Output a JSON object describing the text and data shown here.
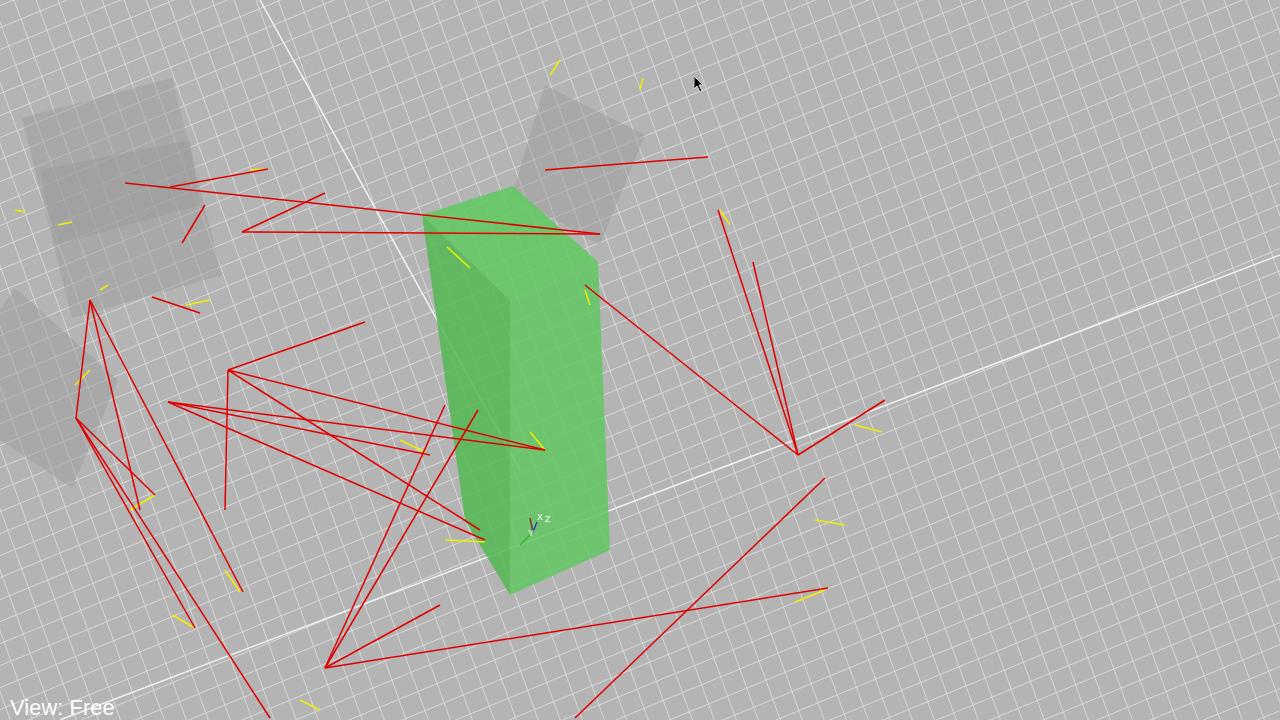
{
  "viewport": {
    "view_label": "View: Free",
    "axis_labels": [
      "X",
      "Z",
      "Y"
    ]
  }
}
